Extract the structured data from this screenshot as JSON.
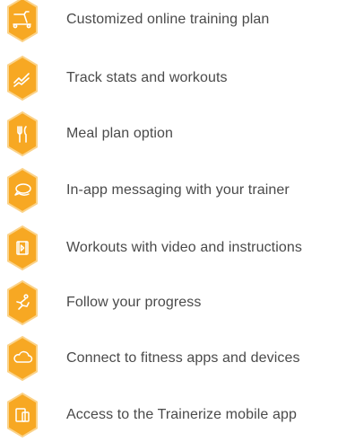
{
  "colors": {
    "badge_fill": "#F7A823",
    "badge_stroke": "#FBD38A",
    "icon_stroke": "#FFFFFF",
    "text": "#4A4A4A"
  },
  "features": [
    {
      "icon": "treadmill-icon",
      "label": "Customized online training plan"
    },
    {
      "icon": "chart-line-icon",
      "label": "Track stats and workouts"
    },
    {
      "icon": "fork-knife-icon",
      "label": "Meal plan option"
    },
    {
      "icon": "chat-bubbles-icon",
      "label": "In-app messaging with your trainer"
    },
    {
      "icon": "video-play-icon",
      "label": "Workouts with video and instructions"
    },
    {
      "icon": "running-person-icon",
      "label": "Follow your progress"
    },
    {
      "icon": "cloud-icon",
      "label": "Connect to fitness apps and devices"
    },
    {
      "icon": "mobile-devices-icon",
      "label": "Access to the Trainerize mobile app"
    }
  ]
}
